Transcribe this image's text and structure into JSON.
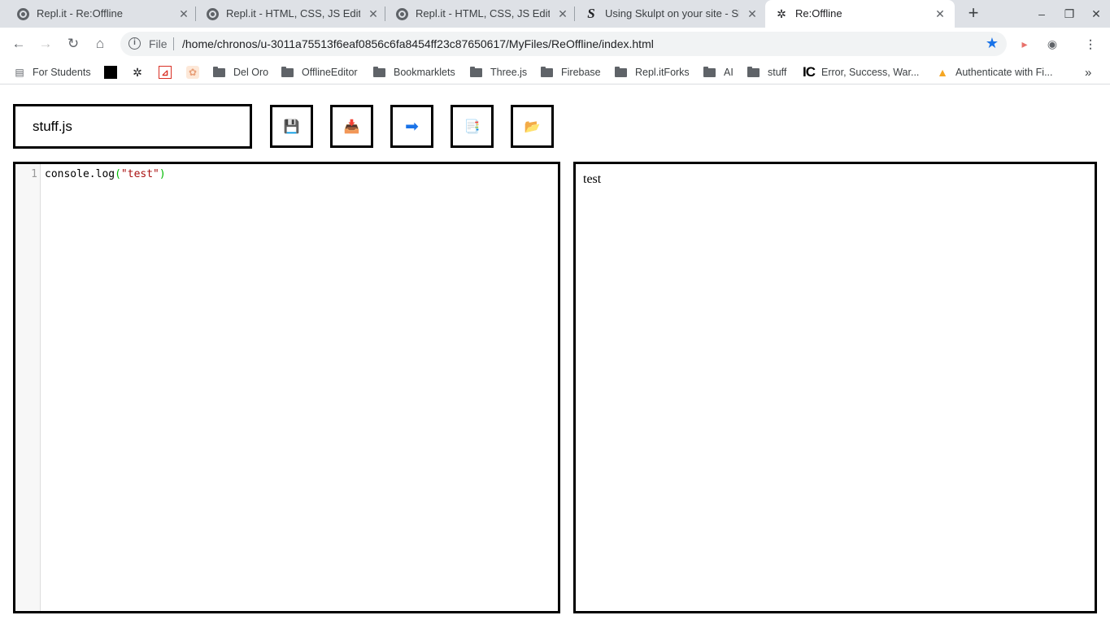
{
  "browser": {
    "tabs": [
      {
        "title": "Repl.it - Re:Offline",
        "icon": "replit-icon"
      },
      {
        "title": "Repl.it - HTML, CSS, JS Editor",
        "icon": "replit-icon"
      },
      {
        "title": "Repl.it - HTML, CSS, JS Editor",
        "icon": "replit-icon"
      },
      {
        "title": "Using Skulpt on your site - Sk",
        "icon": "skulpt-icon"
      },
      {
        "title": "Re:Offline",
        "icon": "gear-icon",
        "active": true
      }
    ],
    "address": {
      "scheme": "File",
      "url": "/home/chronos/u-3011a75513f6eaf0856c6fa8454ff23c87650617/MyFiles/ReOffline/index.html"
    },
    "bookmarks": [
      {
        "label": "For Students",
        "icon": "apps-icon"
      },
      {
        "label": "",
        "icon": "black-square-icon"
      },
      {
        "label": "",
        "icon": "gear-icon"
      },
      {
        "label": "",
        "icon": "pdf-icon"
      },
      {
        "label": "",
        "icon": "image-icon"
      },
      {
        "label": "Del Oro",
        "icon": "folder-icon"
      },
      {
        "label": "OfflineEditor",
        "icon": "folder-icon"
      },
      {
        "label": "Bookmarklets",
        "icon": "folder-icon"
      },
      {
        "label": "Three.js",
        "icon": "folder-icon"
      },
      {
        "label": "Firebase",
        "icon": "folder-icon"
      },
      {
        "label": "Repl.itForks",
        "icon": "folder-icon"
      },
      {
        "label": "AI",
        "icon": "folder-icon"
      },
      {
        "label": "stuff",
        "icon": "folder-icon"
      },
      {
        "label": "Error, Success, War...",
        "icon": "ic-logo-icon"
      },
      {
        "label": "Authenticate with Fi...",
        "icon": "firebase-icon"
      }
    ],
    "more_bookmarks": "»"
  },
  "app": {
    "filename": "stuff.js",
    "buttons": [
      {
        "name": "save-button",
        "icon": "floppy-disk-icon",
        "glyph": "💾"
      },
      {
        "name": "download-button",
        "icon": "inbox-tray-icon",
        "glyph": "📥"
      },
      {
        "name": "run-button",
        "icon": "right-arrow-icon",
        "glyph": "➡"
      },
      {
        "name": "files-button",
        "icon": "page-list-icon",
        "glyph": "📑"
      },
      {
        "name": "open-folder-button",
        "icon": "folder-open-icon",
        "glyph": "📂"
      }
    ],
    "editor": {
      "line_number": "1",
      "code_prefix": "console.log",
      "code_open": "(",
      "code_string": "\"test\"",
      "code_close": ")"
    },
    "output": "test"
  },
  "colors": {
    "accent": "#1a73e8",
    "string": "#aa1111",
    "bracket": "#00bb00"
  }
}
